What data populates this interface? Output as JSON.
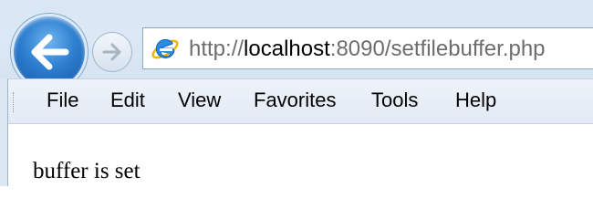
{
  "browser": {
    "url_prefix": "http://",
    "url_host": "localhost",
    "url_rest": ":8090/setfilebuffer.php"
  },
  "menubar": {
    "items": [
      "File",
      "Edit",
      "View",
      "Favorites",
      "Tools",
      "Help"
    ]
  },
  "page": {
    "text": "buffer is set"
  },
  "icons": {
    "back": "back-arrow-icon",
    "forward": "forward-arrow-icon",
    "site": "internet-explorer-icon"
  },
  "colors": {
    "back_button": "#2d7fd0",
    "chrome_background": "#dce8f5"
  }
}
